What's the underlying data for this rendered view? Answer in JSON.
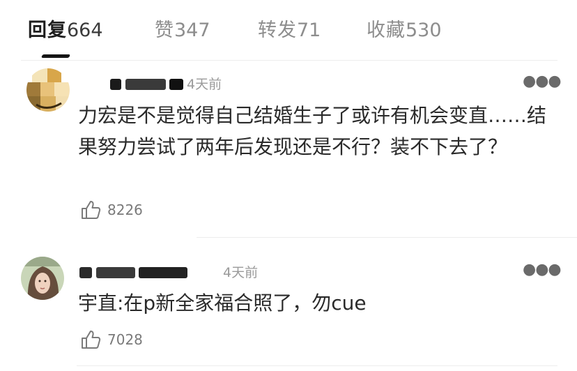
{
  "tabs": [
    {
      "label": "回复",
      "count": "664",
      "active": true
    },
    {
      "label": "赞",
      "count": "347",
      "active": false
    },
    {
      "label": "转发",
      "count": "71",
      "active": false
    },
    {
      "label": "收藏",
      "count": "530",
      "active": false
    }
  ],
  "comments": [
    {
      "username": "",
      "time": "4天前",
      "text": "力宏是不是觉得自己结婚生子了或许有机会变直……结果努力尝试了两年后发现还是不行？装不下去了？",
      "likes": "8226",
      "more_icon": "more-dots-icon"
    },
    {
      "username": "",
      "time": "4天前",
      "text": "宇直:在p新全家福合照了，勿cue",
      "likes": "7028",
      "more_icon": "more-dots-icon"
    }
  ],
  "colors": {
    "active_tab": "#1f1f1f",
    "inactive_tab": "#8d8d8d",
    "meta_text": "#9a9a9a",
    "body_text": "#2a2a2a"
  }
}
